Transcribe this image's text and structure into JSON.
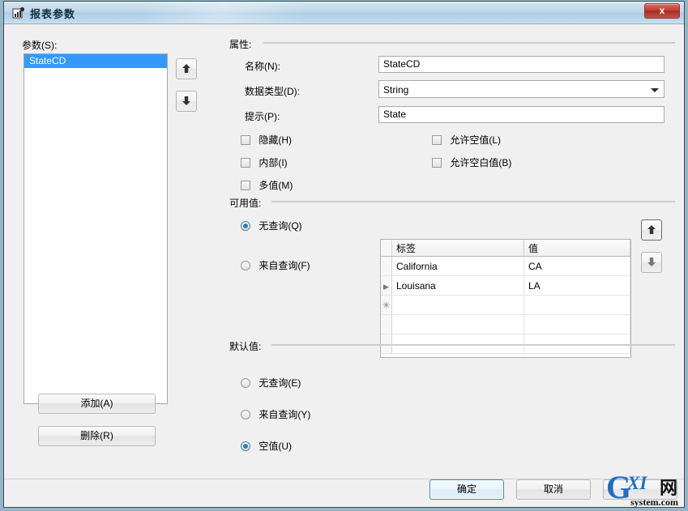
{
  "window": {
    "title": "报表参数",
    "app_icon": "report-parameter-icon",
    "close_label": "x"
  },
  "parameters_panel": {
    "label": "参数(S):",
    "items": [
      {
        "label": "StateCD",
        "selected": true
      }
    ],
    "move_up_label": "▲",
    "move_down_label": "▼",
    "add_button": "添加(A)",
    "delete_button": "删除(R)"
  },
  "properties": {
    "group_label": "属性:",
    "fields": [
      {
        "label": "名称(N):",
        "value": "StateCD",
        "type": "text"
      },
      {
        "label": "数据类型(D):",
        "value": "String",
        "type": "combo"
      },
      {
        "label": "提示(P):",
        "value": "State",
        "type": "text"
      }
    ],
    "checkboxes_left": [
      {
        "label": "隐藏(H)",
        "checked": false
      },
      {
        "label": "内部(I)",
        "checked": false
      },
      {
        "label": "多值(M)",
        "checked": false
      }
    ],
    "checkboxes_right": [
      {
        "label": "允许空值(L)",
        "checked": false
      },
      {
        "label": "允许空白值(B)",
        "checked": false
      }
    ]
  },
  "available_values": {
    "group_label": "可用值:",
    "radios": [
      {
        "label": "无查询(Q)",
        "checked": true
      },
      {
        "label": "来自查询(F)",
        "checked": false
      }
    ],
    "grid": {
      "columns": [
        "标签",
        "值"
      ],
      "rows": [
        {
          "marker": "",
          "label": "California",
          "value": "CA"
        },
        {
          "marker": "▶",
          "label": "Louisana",
          "value": "LA"
        }
      ],
      "new_row_marker": "✳",
      "empty_rows": 2
    },
    "move_up_label": "▲",
    "move_down_label": "▼"
  },
  "default_value": {
    "group_label": "默认值:",
    "radios": [
      {
        "label": "无查询(E)",
        "checked": false
      },
      {
        "label": "来自查询(Y)",
        "checked": false
      },
      {
        "label": "空值(U)",
        "checked": true
      }
    ]
  },
  "footer": {
    "ok_button": "确定",
    "cancel_button": "取消",
    "help_button": ""
  },
  "watermark": {
    "g": "G",
    "xi": "XI",
    "cn": "网",
    "sub": "system.com"
  }
}
